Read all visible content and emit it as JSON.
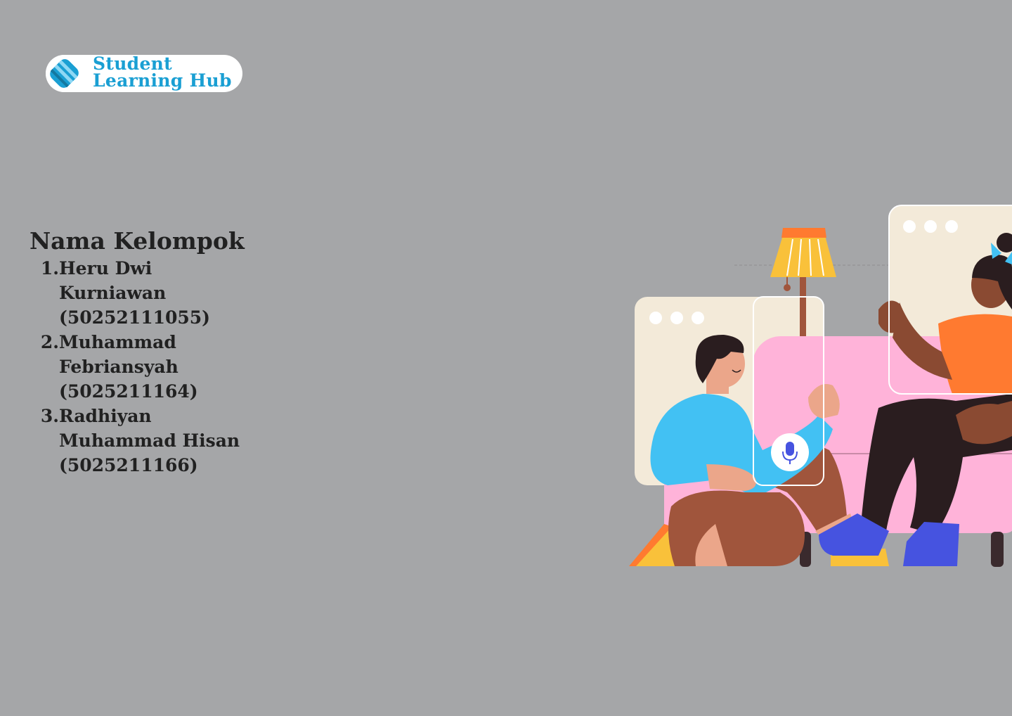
{
  "logo": {
    "line1": "Student",
    "line2": "Learning Hub",
    "brand_color": "#1a9fd3"
  },
  "group": {
    "title": "Nama Kelompok",
    "members": [
      {
        "number": "1.",
        "lines": [
          "Heru Dwi",
          "Kurniawan",
          "(50252111055)"
        ]
      },
      {
        "number": "2.",
        "lines": [
          "Muhammad",
          "Febriansyah",
          "(5025211164)"
        ]
      },
      {
        "number": "3.",
        "lines": [
          "Radhiyan",
          "Muhammad Hisan",
          "(5025211166)"
        ]
      }
    ]
  },
  "colors": {
    "background": "#a5a6a8",
    "text": "#212121",
    "sofa": "#ffb3d9",
    "lamp_shade": "#f9c13a",
    "shirt_left": "#42c1f3",
    "shirt_right": "#ff7a30",
    "shoes": "#4653e0"
  },
  "icons": {
    "logo_mark": "stacked-stripes-logo-icon",
    "mic": "microphone-icon"
  }
}
